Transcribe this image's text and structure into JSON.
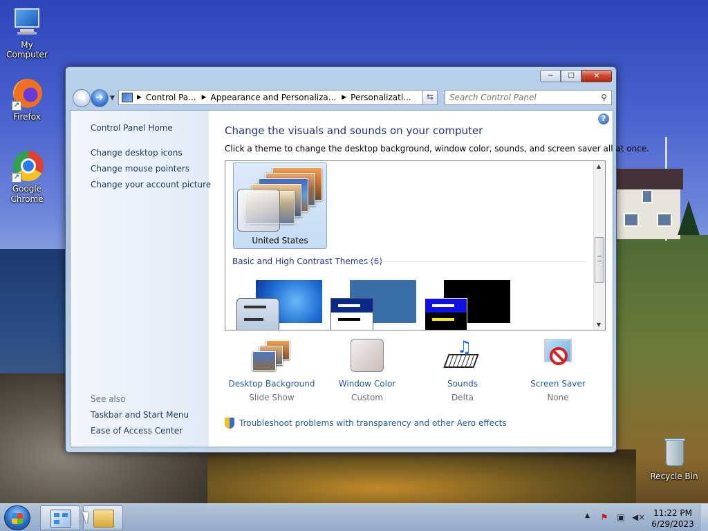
{
  "desktop": {
    "icons": [
      {
        "label": "My Computer",
        "icon": "computer-icon"
      },
      {
        "label": "Firefox",
        "icon": "firefox-icon"
      },
      {
        "label": "Google Chrome",
        "icon": "chrome-icon"
      },
      {
        "label": "Recycle Bin",
        "icon": "recycle-bin-icon"
      }
    ]
  },
  "window": {
    "caption_buttons": {
      "minimize": "─",
      "maximize": "☐",
      "close": "✕"
    },
    "address": {
      "segments": [
        "Control Pa...",
        "Appearance and Personaliza...",
        "Personalizati..."
      ]
    },
    "search": {
      "placeholder": "Search Control Panel"
    },
    "help": "?",
    "left_pane": {
      "home": "Control Panel Home",
      "links": [
        "Change desktop icons",
        "Change mouse pointers",
        "Change your account picture"
      ],
      "see_also_label": "See also",
      "see_also": [
        "Taskbar and Start Menu",
        "Ease of Access Center"
      ]
    },
    "main": {
      "title": "Change the visuals and sounds on your computer",
      "subtitle": "Click a theme to change the desktop background, window color, sounds, and screen saver all at once.",
      "selected_theme": "United States",
      "group_header": "Basic and High Contrast Themes (6)",
      "properties": [
        {
          "link": "Desktop Background",
          "value": "Slide Show",
          "icon": "desktop-background-icon"
        },
        {
          "link": "Window Color",
          "value": "Custom",
          "icon": "window-color-icon"
        },
        {
          "link": "Sounds",
          "value": "Delta",
          "icon": "sounds-icon"
        },
        {
          "link": "Screen Saver",
          "value": "None",
          "icon": "screen-saver-icon"
        }
      ],
      "troubleshoot": "Troubleshoot problems with transparency and other Aero effects"
    }
  },
  "taskbar": {
    "time": "11:22 PM",
    "date": "6/29/2023"
  },
  "colors": {
    "link": "#1e5ba8",
    "title": "#1e3287",
    "left_pane_link": "#1e395b",
    "muted": "#6d6d6d"
  }
}
